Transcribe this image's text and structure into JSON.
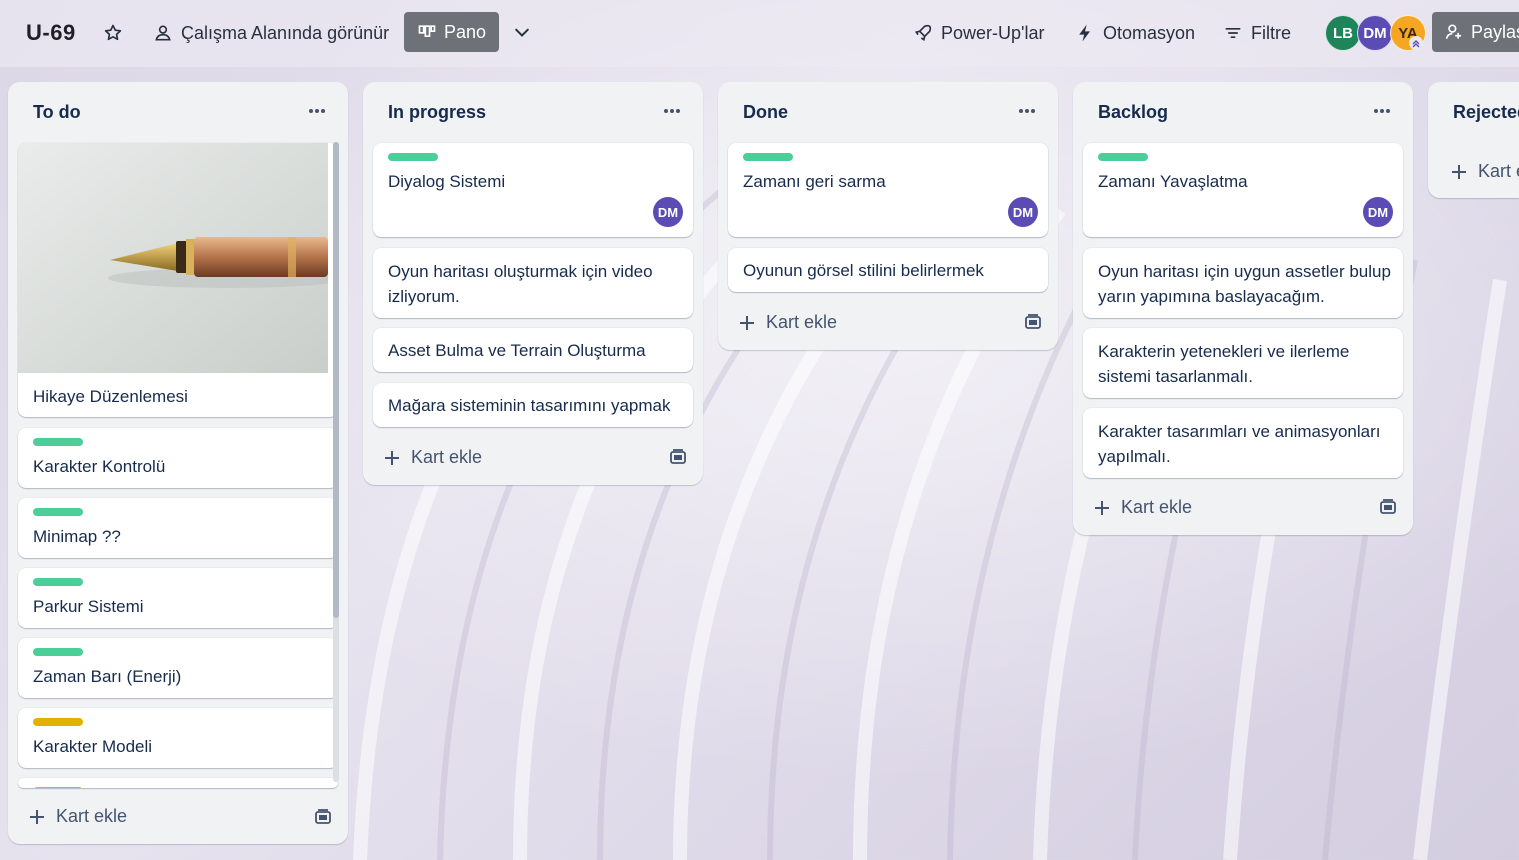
{
  "header": {
    "board_name": "U-69",
    "visibility_label": "Çalışma Alanında görünür",
    "view_label": "Pano",
    "powerups_label": "Power-Up'lar",
    "automation_label": "Otomasyon",
    "filter_label": "Filtre",
    "share_label": "Paylaş",
    "members": [
      {
        "initials": "LB",
        "color": "#1f845a"
      },
      {
        "initials": "DM",
        "color": "#5a4bb5"
      },
      {
        "initials": "YA",
        "color": "#f5a623"
      }
    ]
  },
  "colors": {
    "label_green": "#4bce97",
    "label_yellow": "#e2b203",
    "member_purple": "#5a4bb5"
  },
  "lists": [
    {
      "title": "To do",
      "add_card_label": "Kart ekle",
      "cards": [
        {
          "text": "Hikaye Düzenlemesi",
          "has_cover": true,
          "cover": "fountain-pen photo"
        },
        {
          "text": "Karakter Kontrolü",
          "label": "green"
        },
        {
          "text": "Minimap ??",
          "label": "green"
        },
        {
          "text": "Parkur Sistemi",
          "label": "green"
        },
        {
          "text": "Zaman Barı (Enerji)",
          "label": "green"
        },
        {
          "text": "Karakter Modeli",
          "label": "yellow"
        }
      ]
    },
    {
      "title": "In progress",
      "add_card_label": "Kart ekle",
      "cards": [
        {
          "text": "Diyalog Sistemi",
          "label": "green",
          "member": "DM"
        },
        {
          "text": "Oyun haritası oluşturmak için video izliyorum."
        },
        {
          "text": "Asset Bulma ve Terrain Oluşturma"
        },
        {
          "text": "Mağara sisteminin tasarımını yapmak"
        }
      ]
    },
    {
      "title": "Done",
      "add_card_label": "Kart ekle",
      "cards": [
        {
          "text": "Zamanı geri sarma",
          "label": "green",
          "member": "DM"
        },
        {
          "text": "Oyunun görsel stilini belirlermek"
        }
      ]
    },
    {
      "title": "Backlog",
      "add_card_label": "Kart ekle",
      "cards": [
        {
          "text": "Zamanı Yavaşlatma",
          "label": "green",
          "member": "DM"
        },
        {
          "text": "Oyun haritası için uygun assetler bulup yarın yapımına baslayacağım."
        },
        {
          "text": "Karakterin yetenekleri ve ilerleme sistemi tasarlanmalı."
        },
        {
          "text": "Karakter tasarımları ve animasyonları yapılmalı."
        }
      ]
    },
    {
      "title": "Rejected",
      "add_card_label": "Kart ekle",
      "cards": []
    }
  ]
}
